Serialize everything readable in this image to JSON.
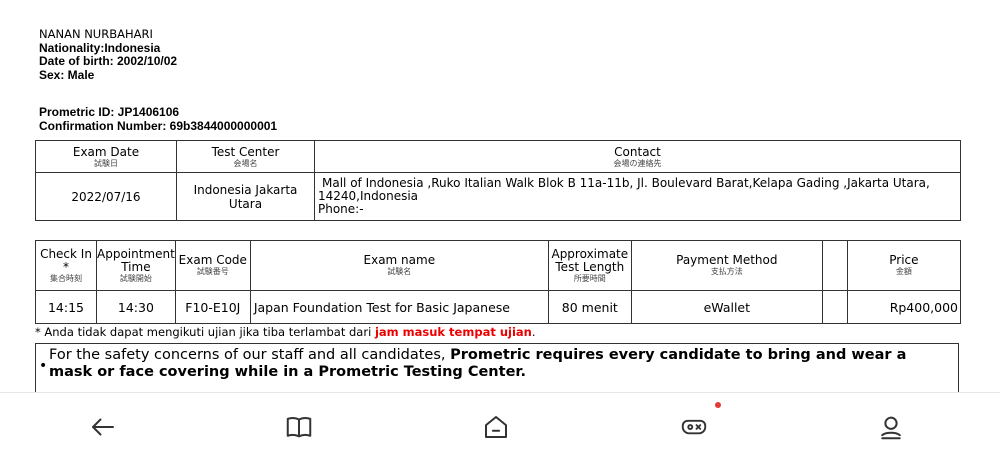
{
  "candidate": {
    "name": "NANAN  NURBAHARI",
    "nationality": "Nationality:Indonesia",
    "dob": "Date of birth: 2002/10/02",
    "sex": "Sex: Male",
    "prometric_id": "Prometric ID: JP1406106",
    "confirmation": "Confirmation Number: 69b3844000000001"
  },
  "table1": {
    "headers": [
      {
        "en": "Exam Date",
        "jp": "試験日"
      },
      {
        "en": "Test Center",
        "jp": "会場名"
      },
      {
        "en": "Contact",
        "jp": "会場の連絡先"
      }
    ],
    "row": {
      "date": "2022/07/16",
      "center": "Indonesia Jakarta Utara",
      "contact_line1": "Mall of Indonesia ,Ruko Italian Walk Blok B 11a-11b, Jl. Boulevard Barat,Kelapa Gading ,Jakarta Utara,",
      "contact_line2": "14240,Indonesia",
      "phone": "Phone:-"
    }
  },
  "table2": {
    "headers": [
      {
        "en": "Check In *",
        "jp": "集合時刻"
      },
      {
        "en": "Appointment Time",
        "jp": "試験開始"
      },
      {
        "en": "Exam Code",
        "jp": "試験番号"
      },
      {
        "en": "Exam name",
        "jp": "試験名"
      },
      {
        "en": "Approximate Test Length",
        "jp": "所要時間"
      },
      {
        "en": "Payment Method",
        "jp": "支払方法"
      },
      {
        "en": "",
        "jp": ""
      },
      {
        "en": "Price",
        "jp": "金額"
      }
    ],
    "row": {
      "checkin": "14:15",
      "appointment": "14:30",
      "code": "F10-E10J",
      "name": "Japan Foundation Test for Basic Japanese",
      "length": "80 menit",
      "payment": "eWallet",
      "blank": "",
      "price": "Rp400,000"
    }
  },
  "note": {
    "prefix": "* Anda tidak dapat mengikuti ujian jika tiba terlambat dari ",
    "highlight": "jam masuk tempat ujian",
    "suffix": "."
  },
  "safety": {
    "part1": "For the safety concerns of our staff and all candidates, ",
    "part2": "Prometric requires every candidate to bring and wear a mask or face covering while in a Prometric Testing Center."
  },
  "navbar": {
    "items": [
      "back-arrow-icon",
      "book-icon",
      "home-icon",
      "gamepad-icon",
      "profile-icon"
    ],
    "accent": "#e53935"
  }
}
